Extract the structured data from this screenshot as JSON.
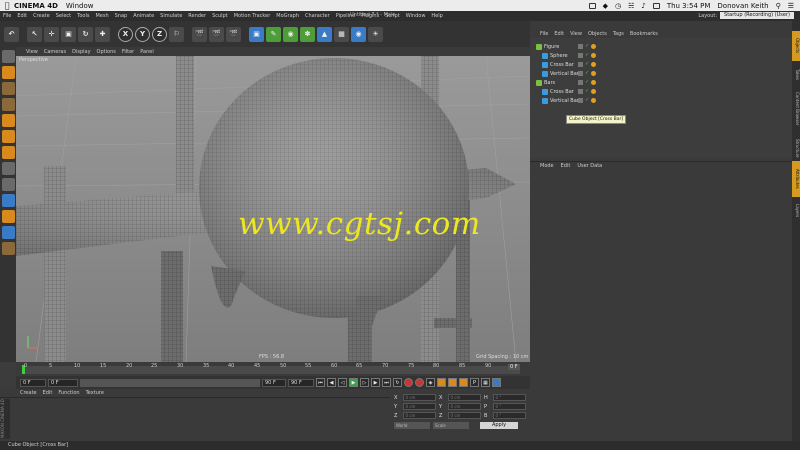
{
  "mac": {
    "app": "CINEMA 4D",
    "menu": [
      "Window"
    ],
    "clock": "Thu 3:54 PM",
    "user": "Donovan Keith"
  },
  "c4d": {
    "menus": [
      "File",
      "Edit",
      "Create",
      "Select",
      "Tools",
      "Mesh",
      "Snap",
      "Animate",
      "Simulate",
      "Render",
      "Sculpt",
      "Motion Tracker",
      "MoGraph",
      "Character",
      "Pipeline",
      "Plugins",
      "Script",
      "Window",
      "Help"
    ],
    "window_title": "Untitled 7 * - Main",
    "layout_label": "Layout:",
    "layout_value": "Startup (Recording) (User)"
  },
  "toolbar": {
    "axis_x": "X",
    "axis_y": "Y",
    "axis_z": "Z"
  },
  "viewport": {
    "menus": [
      "View",
      "Cameras",
      "Display",
      "Options",
      "Filter",
      "Panel"
    ],
    "view_name": "Perspective",
    "fps": "FPS : 56.8",
    "grid_spacing": "Grid Spacing : 10 cm",
    "watermark": "www.cgtsj.com"
  },
  "timeline": {
    "ticks": [
      "0",
      "5",
      "10",
      "15",
      "20",
      "25",
      "30",
      "35",
      "40",
      "45",
      "50",
      "55",
      "60",
      "65",
      "70",
      "75",
      "80",
      "85",
      "90"
    ],
    "end_frame": "0 F"
  },
  "playback": {
    "current": "0 F",
    "start": "0 F",
    "range_end": "90 F",
    "end": "90 F"
  },
  "materials": {
    "menus": [
      "Create",
      "Edit",
      "Function",
      "Texture"
    ],
    "side_label": "MAXON CINEMA 4D"
  },
  "coordinates": {
    "rows": [
      {
        "a": "X",
        "av": "0 cm",
        "b": "X",
        "bv": "0 cm",
        "c": "H",
        "cv": "0 °"
      },
      {
        "a": "Y",
        "av": "0 cm",
        "b": "Y",
        "bv": "0 cm",
        "c": "P",
        "cv": "0 °"
      },
      {
        "a": "Z",
        "av": "0 cm",
        "b": "Z",
        "bv": "0 cm",
        "c": "B",
        "cv": "0 °"
      }
    ],
    "mode": "World",
    "scale": "Scale",
    "apply": "Apply"
  },
  "status": "Cube Object [Cross Bar]",
  "object_manager": {
    "menus": [
      "File",
      "Edit",
      "View",
      "Objects",
      "Tags",
      "Bookmarks"
    ],
    "objects": [
      {
        "name": "Figure",
        "color": "#7fbf3f",
        "indent": 0
      },
      {
        "name": "Sphere",
        "color": "#3a9be0",
        "indent": 1
      },
      {
        "name": "Cross Bar",
        "color": "#3a9be0",
        "indent": 1
      },
      {
        "name": "Vertical Bars",
        "color": "#3a9be0",
        "indent": 1
      },
      {
        "name": "Bars",
        "color": "#7fbf3f",
        "indent": 0
      },
      {
        "name": "Cross Bar",
        "color": "#3a9be0",
        "indent": 1
      },
      {
        "name": "Vertical Bars",
        "color": "#3a9be0",
        "indent": 1
      }
    ],
    "tooltip": "Cube Object [Cross Bar]"
  },
  "attributes": {
    "menus": [
      "Mode",
      "Edit",
      "User Data"
    ]
  },
  "vtabs": [
    "Objects",
    "Takes",
    "Content Browser",
    "Structure",
    "Attributes",
    "Layers"
  ]
}
